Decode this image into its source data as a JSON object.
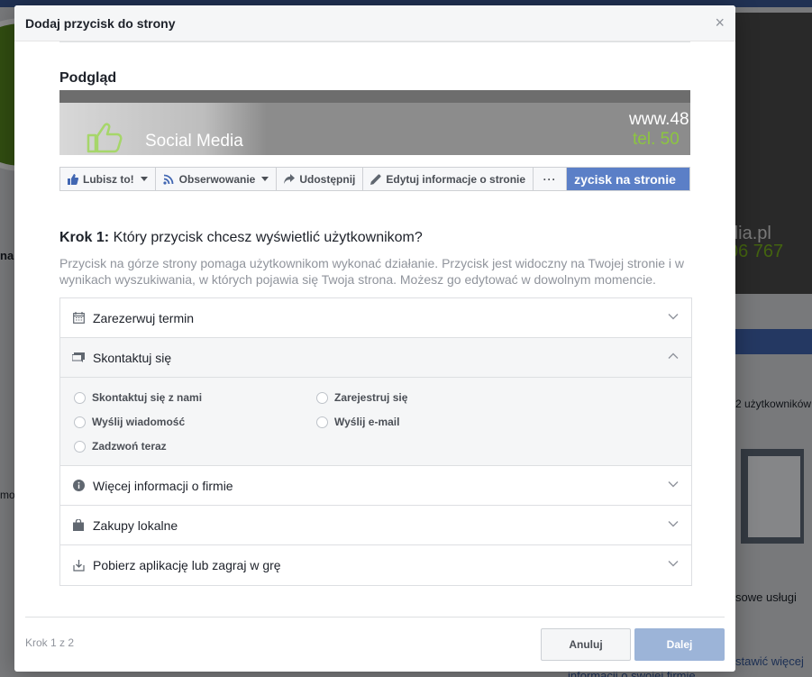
{
  "background": {
    "left_label": "na",
    "left_label2": "mo",
    "cover_url": "dia.pl",
    "cover_tel": "06 767",
    "users_text": "2 użytkowników",
    "services_text": "sowe usługi",
    "link1": "stawić więcej",
    "link2": "informacji o swojej firmie"
  },
  "modal": {
    "title": "Dodaj przycisk do strony",
    "close_glyph": "×",
    "preview_label": "Podgląd",
    "cover": {
      "brand": "Social Media",
      "url": "www.48",
      "tel": "tel. 50"
    },
    "actionbar": {
      "like": "Lubisz to!",
      "follow": "Obserwowanie",
      "share": "Udostępnij",
      "edit": "Edytuj informacje o stronie",
      "more": "···",
      "primary": "zycisk na stronie"
    },
    "step": {
      "prefix": "Krok 1:",
      "question": " Który przycisk chcesz wyświetlić użytkownikom?",
      "description": "Przycisk na górze strony pomaga użytkownikom wykonać działanie. Przycisk jest widoczny na Twojej stronie i w wynikach wyszukiwania, w których pojawia się Twoja strona. Możesz go edytować w dowolnym momencie."
    },
    "accordion": {
      "items": [
        {
          "label": "Zarezerwuj termin",
          "icon": "calendar-icon"
        },
        {
          "label": "Skontaktuj się",
          "icon": "chat-icon"
        },
        {
          "label": "Więcej informacji o firmie",
          "icon": "info-icon"
        },
        {
          "label": "Zakupy lokalne",
          "icon": "shopping-bag-icon"
        },
        {
          "label": "Pobierz aplikację lub zagraj w grę",
          "icon": "download-icon"
        }
      ],
      "contact_options": [
        "Skontaktuj się z nami",
        "Zarejestruj się",
        "Wyślij wiadomość",
        "Wyślij e-mail",
        "Zadzwoń teraz"
      ]
    },
    "footer": {
      "step_counter": "Krok 1 z 2",
      "cancel": "Anuluj",
      "next": "Dalej"
    }
  },
  "colors": {
    "brand_blue": "#4267b2",
    "primary_button": "#5b7fc7",
    "next_disabled": "#9cb4d8",
    "green": "#8cc63f"
  }
}
